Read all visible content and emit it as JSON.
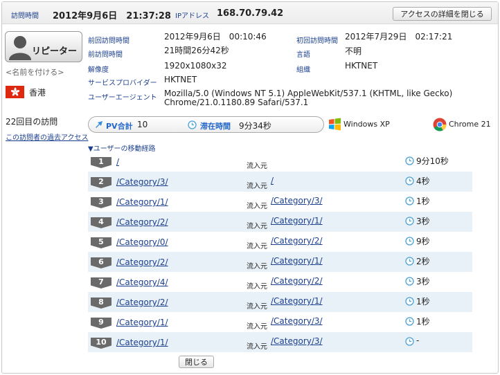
{
  "header": {
    "visit_time_label": "訪問時間",
    "visit_time_value": "2012年9月6日　21:37:28",
    "ip_label": "IPアドレス",
    "ip_value": "168.70.79.42",
    "close_detail_label": "アクセスの詳細を閉じる"
  },
  "visitor": {
    "badge_label": "リピーター",
    "name_link": "<名前を付ける>",
    "country": "香港",
    "visit_count": "22回目の訪問",
    "past_access_link": "この訪問者の過去アクセス"
  },
  "info": {
    "prev_visit_label": "前回訪問時間",
    "prev_visit_value": "2012年9月6日　00:10:46",
    "first_visit_label": "初回訪問時間",
    "first_visit_value": "2012年7月29日　02:17:21",
    "since_prev_label": "前訪問時間",
    "since_prev_value": "21時間26分42秒",
    "language_label": "言語",
    "language_value": "不明",
    "resolution_label": "解像度",
    "resolution_value": "1920x1080x32",
    "org_label": "組織",
    "org_value": "HKTNET",
    "isp_label": "サービスプロバイダー",
    "isp_value": "HKTNET",
    "ua_label": "ユーザーエージェント",
    "ua_line1": "Mozilla/5.0 (Windows NT 5.1) AppleWebKit/537.1 (KHTML, like Gecko)",
    "ua_line2": "Chrome/21.0.1180.89 Safari/537.1"
  },
  "summary": {
    "pv_label": "PV合計",
    "pv_value": "10",
    "stay_label": "滞在時間",
    "stay_value": "9分34秒",
    "os": "Windows XP",
    "browser": "Chrome 21"
  },
  "route_title": "▼ユーザーの移動経路",
  "route_referrer_label": "流入元",
  "routes": [
    {
      "num": "1",
      "page": "/",
      "ref": "",
      "duration": "9分10秒"
    },
    {
      "num": "2",
      "page": "/Category/3/",
      "ref": "/",
      "duration": "4秒"
    },
    {
      "num": "3",
      "page": "/Category/1/",
      "ref": "/Category/3/",
      "duration": "1秒"
    },
    {
      "num": "4",
      "page": "/Category/2/",
      "ref": "/Category/1/",
      "duration": "3秒"
    },
    {
      "num": "5",
      "page": "/Category/0/",
      "ref": "/Category/2/",
      "duration": "9秒"
    },
    {
      "num": "6",
      "page": "/Category/2/",
      "ref": "/Category/1/",
      "duration": "2秒"
    },
    {
      "num": "7",
      "page": "/Category/4/",
      "ref": "/Category/2/",
      "duration": "3秒"
    },
    {
      "num": "8",
      "page": "/Category/2/",
      "ref": "/Category/1/",
      "duration": "1秒"
    },
    {
      "num": "9",
      "page": "/Category/1/",
      "ref": "/Category/3/",
      "duration": "1秒"
    },
    {
      "num": "10",
      "page": "/Category/1/",
      "ref": "/Category/3/",
      "duration": "-"
    }
  ],
  "close_label": "閉じる",
  "icons": {
    "avatar": "user-silhouette-icon",
    "flag": "hong-kong-flag-icon",
    "pv": "arrow-cursor-icon",
    "stay": "clock-icon",
    "os": "windows-logo-icon",
    "browser": "chrome-logo-icon",
    "duration": "clock-icon"
  },
  "colors": {
    "label_blue": "#1b3f8f",
    "row_alt": "#e8f1f7",
    "step_badge": "#6a6a6a",
    "flag_red": "#de2910"
  }
}
